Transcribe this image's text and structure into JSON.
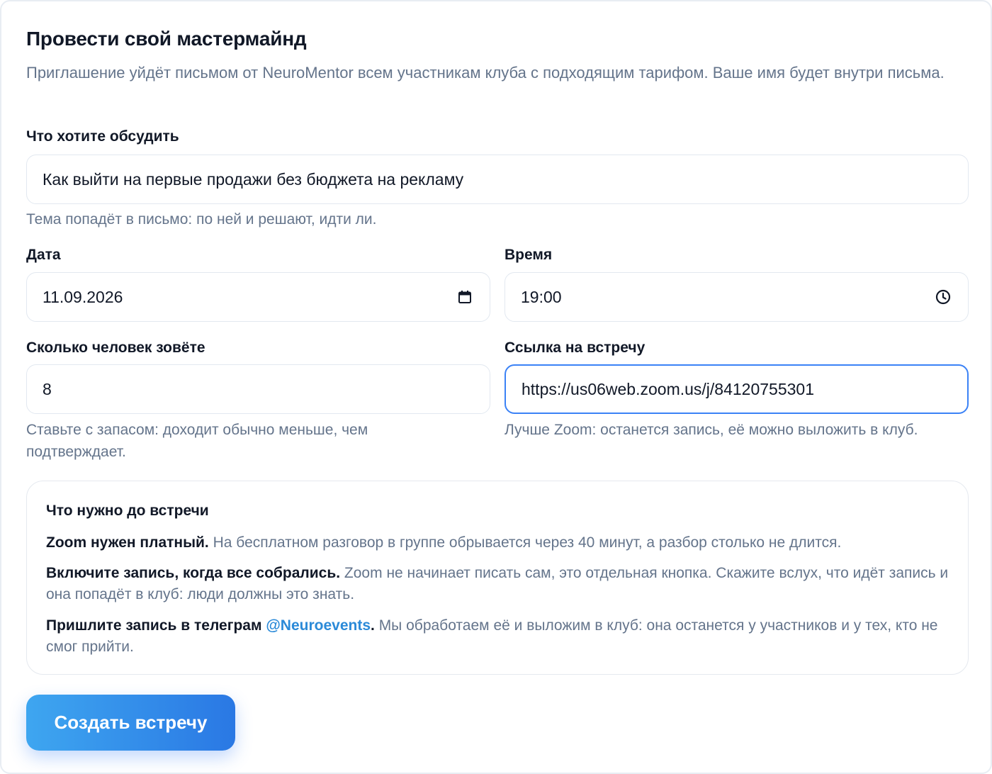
{
  "page": {
    "title": "Провести свой мастермайнд",
    "subtitle": "Приглашение уйдёт письмом от NeuroMentor всем участникам клуба с подходящим тарифом. Ваше имя будет внутри письма."
  },
  "topic": {
    "label": "Что хотите обсудить",
    "value": "Как выйти на первые продажи без бюджета на рекламу",
    "hint": "Тема попадёт в письмо: по ней и решают, идти ли."
  },
  "date": {
    "label": "Дата",
    "value": "11.09.2026",
    "icon": "calendar-icon"
  },
  "time": {
    "label": "Время",
    "value": "19:00",
    "icon": "clock-icon"
  },
  "people": {
    "label": "Сколько человек зовёте",
    "value": "8",
    "hint": "Ставьте с запасом: доходит обычно меньше, чем подтверждает."
  },
  "link": {
    "label": "Ссылка на встречу",
    "value": "https://us06web.zoom.us/j/84120755301",
    "hint": "Лучше Zoom: останется запись, её можно выложить в клуб."
  },
  "info": {
    "title": "Что нужно до встречи",
    "items": [
      {
        "bold": "Zoom нужен платный.",
        "text": " На бесплатном разговор в группе обрывается через 40 минут, а разбор столько не длится."
      },
      {
        "bold": "Включите запись, когда все собрались.",
        "text": " Zoom не начинает писать сам, это отдельная кнопка. Скажите вслух, что идёт запись и она попадёт в клуб: люди должны это знать."
      },
      {
        "bold": "Пришлите запись в телеграм ",
        "link": "@Neuroevents",
        "bold_after": ".",
        "text": " Мы обработаем её и выложим в клуб: она останется у участников и у тех, кто не смог прийти."
      }
    ]
  },
  "submit": {
    "label": "Создать встречу"
  },
  "colors": {
    "accent": "#2a78e4",
    "link": "#2b8ad8",
    "muted": "#64748b",
    "focus_border": "#3b82f6"
  }
}
